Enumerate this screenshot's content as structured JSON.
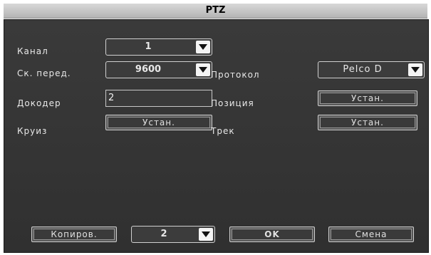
{
  "window": {
    "title": "PTZ"
  },
  "fields": {
    "channel": {
      "label": "Канал",
      "value": "1"
    },
    "baud": {
      "label": "Ск. перед.",
      "value": "9600"
    },
    "protocol": {
      "label": "Протокол",
      "value": "Pelco D"
    },
    "decoder": {
      "label": "Докодер",
      "value": "2"
    },
    "position": {
      "label": "Позиция",
      "button": "Устан."
    },
    "cruise": {
      "label": "Круиз",
      "button": "Устан."
    },
    "track": {
      "label": "Трек",
      "button": "Устан."
    }
  },
  "footer": {
    "copy_label": "Копиров.",
    "copy_target": "2",
    "ok_label": "OK",
    "cancel_label": "Смена"
  },
  "icons": {
    "dropdown": "triangle-down-icon"
  }
}
